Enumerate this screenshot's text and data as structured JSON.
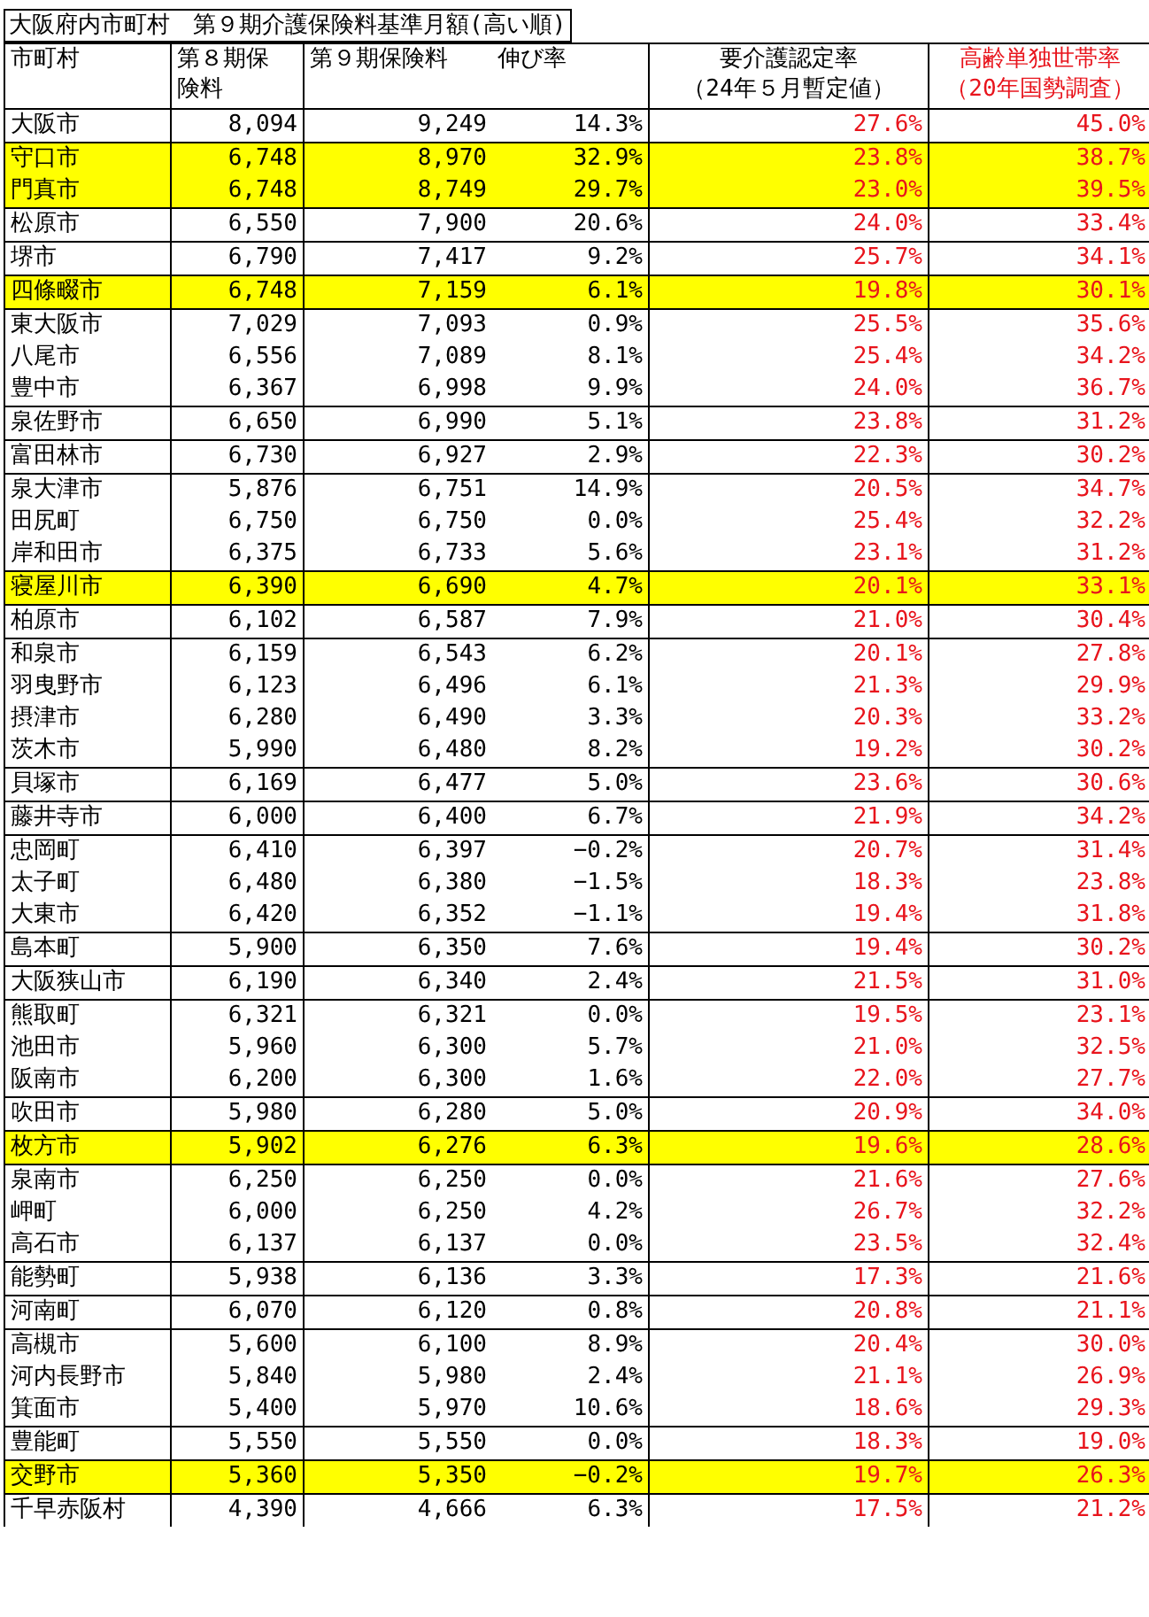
{
  "title": "大阪府内市町村　第９期介護保険料基準月額(高い順)",
  "header": {
    "municipality": "市町村",
    "period8": [
      "第８期保",
      "険料"
    ],
    "period9": "第９期保険料",
    "growth": "伸び率",
    "care_rate": [
      "要介護認定率",
      "（24年５月暫定値）"
    ],
    "single_rate": [
      "高齢単独世帯率",
      "（20年国勢調査）"
    ]
  },
  "groups": [
    {
      "highlighted": false,
      "rows": [
        {
          "name": "大阪市",
          "p8": "8,094",
          "p9": "9,249",
          "growth": "14.3%",
          "care": "27.6%",
          "single": "45.0%"
        }
      ]
    },
    {
      "highlighted": true,
      "rows": [
        {
          "name": "守口市",
          "p8": "6,748",
          "p9": "8,970",
          "growth": "32.9%",
          "care": "23.8%",
          "single": "38.7%"
        },
        {
          "name": "門真市",
          "p8": "6,748",
          "p9": "8,749",
          "growth": "29.7%",
          "care": "23.0%",
          "single": "39.5%"
        }
      ]
    },
    {
      "highlighted": false,
      "rows": [
        {
          "name": "松原市",
          "p8": "6,550",
          "p9": "7,900",
          "growth": "20.6%",
          "care": "24.0%",
          "single": "33.4%"
        }
      ]
    },
    {
      "highlighted": false,
      "rows": [
        {
          "name": "堺市",
          "p8": "6,790",
          "p9": "7,417",
          "growth": "9.2%",
          "care": "25.7%",
          "single": "34.1%"
        }
      ]
    },
    {
      "highlighted": true,
      "rows": [
        {
          "name": "四條畷市",
          "p8": "6,748",
          "p9": "7,159",
          "growth": "6.1%",
          "care": "19.8%",
          "single": "30.1%"
        }
      ]
    },
    {
      "highlighted": false,
      "rows": [
        {
          "name": "東大阪市",
          "p8": "7,029",
          "p9": "7,093",
          "growth": "0.9%",
          "care": "25.5%",
          "single": "35.6%"
        },
        {
          "name": "八尾市",
          "p8": "6,556",
          "p9": "7,089",
          "growth": "8.1%",
          "care": "25.4%",
          "single": "34.2%"
        },
        {
          "name": "豊中市",
          "p8": "6,367",
          "p9": "6,998",
          "growth": "9.9%",
          "care": "24.0%",
          "single": "36.7%"
        }
      ]
    },
    {
      "highlighted": false,
      "rows": [
        {
          "name": "泉佐野市",
          "p8": "6,650",
          "p9": "6,990",
          "growth": "5.1%",
          "care": "23.8%",
          "single": "31.2%"
        }
      ]
    },
    {
      "highlighted": false,
      "rows": [
        {
          "name": "富田林市",
          "p8": "6,730",
          "p9": "6,927",
          "growth": "2.9%",
          "care": "22.3%",
          "single": "30.2%"
        }
      ]
    },
    {
      "highlighted": false,
      "rows": [
        {
          "name": "泉大津市",
          "p8": "5,876",
          "p9": "6,751",
          "growth": "14.9%",
          "care": "20.5%",
          "single": "34.7%"
        },
        {
          "name": "田尻町",
          "p8": "6,750",
          "p9": "6,750",
          "growth": "0.0%",
          "care": "25.4%",
          "single": "32.2%"
        },
        {
          "name": "岸和田市",
          "p8": "6,375",
          "p9": "6,733",
          "growth": "5.6%",
          "care": "23.1%",
          "single": "31.2%"
        }
      ]
    },
    {
      "highlighted": true,
      "rows": [
        {
          "name": "寝屋川市",
          "p8": "6,390",
          "p9": "6,690",
          "growth": "4.7%",
          "care": "20.1%",
          "single": "33.1%"
        }
      ]
    },
    {
      "highlighted": false,
      "rows": [
        {
          "name": "柏原市",
          "p8": "6,102",
          "p9": "6,587",
          "growth": "7.9%",
          "care": "21.0%",
          "single": "30.4%"
        }
      ]
    },
    {
      "highlighted": false,
      "rows": [
        {
          "name": "和泉市",
          "p8": "6,159",
          "p9": "6,543",
          "growth": "6.2%",
          "care": "20.1%",
          "single": "27.8%"
        },
        {
          "name": "羽曳野市",
          "p8": "6,123",
          "p9": "6,496",
          "growth": "6.1%",
          "care": "21.3%",
          "single": "29.9%"
        },
        {
          "name": "摂津市",
          "p8": "6,280",
          "p9": "6,490",
          "growth": "3.3%",
          "care": "20.3%",
          "single": "33.2%"
        },
        {
          "name": "茨木市",
          "p8": "5,990",
          "p9": "6,480",
          "growth": "8.2%",
          "care": "19.2%",
          "single": "30.2%"
        }
      ]
    },
    {
      "highlighted": false,
      "rows": [
        {
          "name": "貝塚市",
          "p8": "6,169",
          "p9": "6,477",
          "growth": "5.0%",
          "care": "23.6%",
          "single": "30.6%"
        }
      ]
    },
    {
      "highlighted": false,
      "rows": [
        {
          "name": "藤井寺市",
          "p8": "6,000",
          "p9": "6,400",
          "growth": "6.7%",
          "care": "21.9%",
          "single": "34.2%"
        }
      ]
    },
    {
      "highlighted": false,
      "rows": [
        {
          "name": "忠岡町",
          "p8": "6,410",
          "p9": "6,397",
          "growth": "−0.2%",
          "care": "20.7%",
          "single": "31.4%"
        },
        {
          "name": "太子町",
          "p8": "6,480",
          "p9": "6,380",
          "growth": "−1.5%",
          "care": "18.3%",
          "single": "23.8%"
        },
        {
          "name": "大東市",
          "p8": "6,420",
          "p9": "6,352",
          "growth": "−1.1%",
          "care": "19.4%",
          "single": "31.8%"
        }
      ]
    },
    {
      "highlighted": false,
      "rows": [
        {
          "name": "島本町",
          "p8": "5,900",
          "p9": "6,350",
          "growth": "7.6%",
          "care": "19.4%",
          "single": "30.2%"
        }
      ]
    },
    {
      "highlighted": false,
      "rows": [
        {
          "name": "大阪狭山市",
          "p8": "6,190",
          "p9": "6,340",
          "growth": "2.4%",
          "care": "21.5%",
          "single": "31.0%"
        }
      ]
    },
    {
      "highlighted": false,
      "rows": [
        {
          "name": "熊取町",
          "p8": "6,321",
          "p9": "6,321",
          "growth": "0.0%",
          "care": "19.5%",
          "single": "23.1%"
        },
        {
          "name": "池田市",
          "p8": "5,960",
          "p9": "6,300",
          "growth": "5.7%",
          "care": "21.0%",
          "single": "32.5%"
        },
        {
          "name": "阪南市",
          "p8": "6,200",
          "p9": "6,300",
          "growth": "1.6%",
          "care": "22.0%",
          "single": "27.7%"
        }
      ]
    },
    {
      "highlighted": false,
      "rows": [
        {
          "name": "吹田市",
          "p8": "5,980",
          "p9": "6,280",
          "growth": "5.0%",
          "care": "20.9%",
          "single": "34.0%"
        }
      ]
    },
    {
      "highlighted": true,
      "rows": [
        {
          "name": "枚方市",
          "p8": "5,902",
          "p9": "6,276",
          "growth": "6.3%",
          "care": "19.6%",
          "single": "28.6%"
        }
      ]
    },
    {
      "highlighted": false,
      "rows": [
        {
          "name": "泉南市",
          "p8": "6,250",
          "p9": "6,250",
          "growth": "0.0%",
          "care": "21.6%",
          "single": "27.6%"
        },
        {
          "name": "岬町",
          "p8": "6,000",
          "p9": "6,250",
          "growth": "4.2%",
          "care": "26.7%",
          "single": "32.2%"
        },
        {
          "name": "高石市",
          "p8": "6,137",
          "p9": "6,137",
          "growth": "0.0%",
          "care": "23.5%",
          "single": "32.4%"
        }
      ]
    },
    {
      "highlighted": false,
      "rows": [
        {
          "name": "能勢町",
          "p8": "5,938",
          "p9": "6,136",
          "growth": "3.3%",
          "care": "17.3%",
          "single": "21.6%"
        }
      ]
    },
    {
      "highlighted": false,
      "rows": [
        {
          "name": "河南町",
          "p8": "6,070",
          "p9": "6,120",
          "growth": "0.8%",
          "care": "20.8%",
          "single": "21.1%"
        }
      ]
    },
    {
      "highlighted": false,
      "rows": [
        {
          "name": "高槻市",
          "p8": "5,600",
          "p9": "6,100",
          "growth": "8.9%",
          "care": "20.4%",
          "single": "30.0%"
        },
        {
          "name": "河内長野市",
          "p8": "5,840",
          "p9": "5,980",
          "growth": "2.4%",
          "care": "21.1%",
          "single": "26.9%"
        },
        {
          "name": "箕面市",
          "p8": "5,400",
          "p9": "5,970",
          "growth": "10.6%",
          "care": "18.6%",
          "single": "29.3%"
        }
      ]
    },
    {
      "highlighted": false,
      "rows": [
        {
          "name": "豊能町",
          "p8": "5,550",
          "p9": "5,550",
          "growth": "0.0%",
          "care": "18.3%",
          "single": "19.0%"
        }
      ]
    },
    {
      "highlighted": true,
      "rows": [
        {
          "name": "交野市",
          "p8": "5,360",
          "p9": "5,350",
          "growth": "−0.2%",
          "care": "19.7%",
          "single": "26.3%"
        }
      ]
    },
    {
      "highlighted": false,
      "rows": [
        {
          "name": "千早赤阪村",
          "p8": "4,390",
          "p9": "4,666",
          "growth": "6.3%",
          "care": "17.5%",
          "single": "21.2%"
        }
      ]
    }
  ]
}
